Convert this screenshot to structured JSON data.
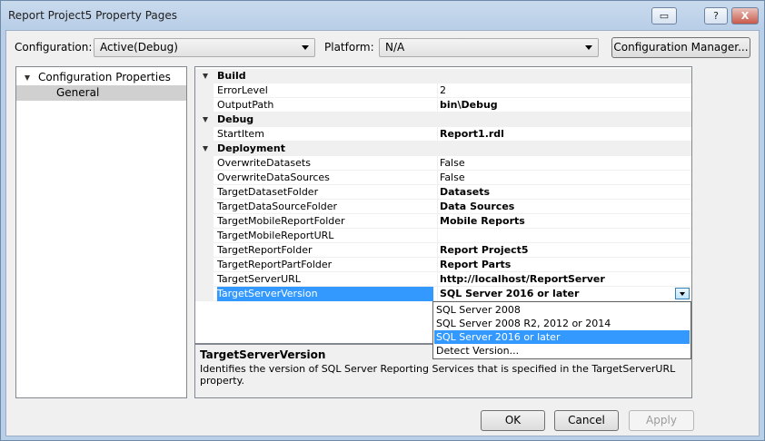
{
  "window": {
    "title": "Report Project5 Property Pages",
    "help_label": "?",
    "close_label": "X",
    "extra_label": "▭"
  },
  "config": {
    "configuration_label": "Configuration:",
    "configuration_value": "Active(Debug)",
    "platform_label": "Platform:",
    "platform_value": "N/A",
    "manager_button": "Configuration Manager..."
  },
  "tree": {
    "root": "Configuration Properties",
    "child": "General"
  },
  "grid": {
    "categories": {
      "build": "Build",
      "debug": "Debug",
      "deployment": "Deployment"
    },
    "rows": [
      {
        "name": "ErrorLevel",
        "value": "2"
      },
      {
        "name": "OutputPath",
        "value": "bin\\Debug"
      },
      {
        "name": "StartItem",
        "value": "Report1.rdl"
      },
      {
        "name": "OverwriteDatasets",
        "value": "False"
      },
      {
        "name": "OverwriteDataSources",
        "value": "False"
      },
      {
        "name": "TargetDatasetFolder",
        "value": "Datasets"
      },
      {
        "name": "TargetDataSourceFolder",
        "value": "Data Sources"
      },
      {
        "name": "TargetMobileReportFolder",
        "value": "Mobile Reports"
      },
      {
        "name": "TargetMobileReportURL",
        "value": ""
      },
      {
        "name": "TargetReportFolder",
        "value": "Report Project5"
      },
      {
        "name": "TargetReportPartFolder",
        "value": "Report Parts"
      },
      {
        "name": "TargetServerURL",
        "value": "http://localhost/ReportServer"
      },
      {
        "name": "TargetServerVersion",
        "value": "SQL Server 2016 or later"
      }
    ]
  },
  "dropdown": {
    "options": [
      "SQL Server 2008",
      "SQL Server 2008 R2, 2012 or 2014",
      "SQL Server 2016 or later",
      "Detect Version..."
    ],
    "selected": "SQL Server 2016 or later"
  },
  "description": {
    "title": "TargetServerVersion",
    "text": "Identifies the version of SQL Server Reporting Services that is specified in the TargetServerURL property."
  },
  "buttons": {
    "ok": "OK",
    "cancel": "Cancel",
    "apply": "Apply"
  },
  "colors": {
    "selection": "#3399ff"
  }
}
